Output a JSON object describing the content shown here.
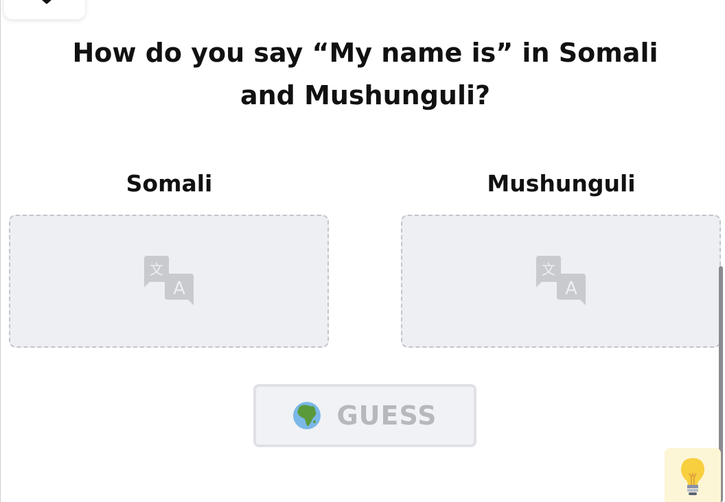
{
  "question": {
    "title": "How do you say “My name is” in Somali and Mushunguli?"
  },
  "languages": [
    {
      "label": "Somali",
      "drop_icon": "translate-icon"
    },
    {
      "label": "Mushunguli",
      "drop_icon": "translate-icon"
    }
  ],
  "actions": {
    "guess_label": "GUESS",
    "guess_icon": "globe-africa-icon",
    "hint_icon": "lightbulb-icon"
  },
  "colors": {
    "drop_bg": "#eeeff3",
    "guess_disabled_text": "#b7b8bd",
    "hint_bg": "#fdf6d6"
  }
}
